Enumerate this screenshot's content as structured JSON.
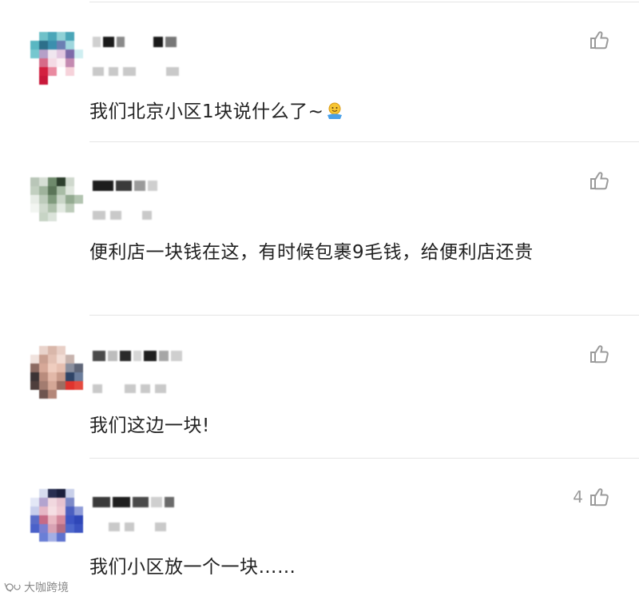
{
  "comments": [
    {
      "text": "我们北京小区1块说什么了~",
      "emoji_icon": "smiley-shrug-emoji",
      "like_count": ""
    },
    {
      "text": "便利店一块钱在这，有时候包裹9毛钱，给便利店还贵",
      "like_count": ""
    },
    {
      "text": "我们这边一块!",
      "like_count": ""
    },
    {
      "text": "我们小区放一个一块……",
      "like_count": "4"
    }
  ],
  "watermark": {
    "text": "大咖跨境",
    "icon": "watermark-logo-icon"
  },
  "colors": {
    "divider": "#e4e4e4",
    "like_icon": "#9a9a9a",
    "body_text": "#222222"
  }
}
